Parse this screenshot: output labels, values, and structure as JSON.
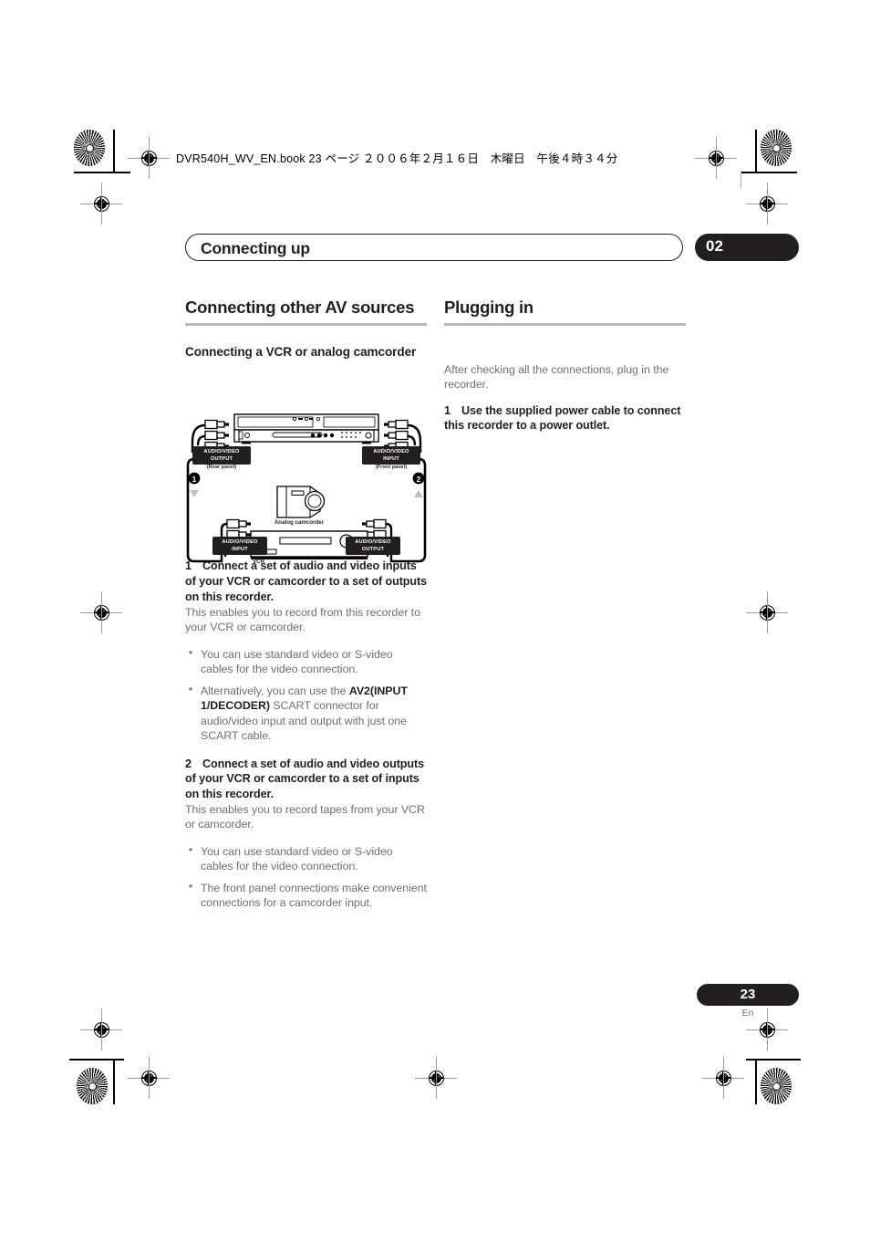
{
  "print_marks": {
    "book_line": "DVR540H_WV_EN.book  23 ページ  ２００６年２月１６日　木曜日　午後４時３４分"
  },
  "running_head": {
    "title": "Connecting up",
    "chapter_number": "02"
  },
  "left_column": {
    "section_title": "Connecting other AV sources",
    "subsection_title": "Connecting a VCR or analog camcorder",
    "step1": {
      "number": "1",
      "heading": "Connect a set of audio and video inputs of your VCR or camcorder to a set of outputs on this recorder.",
      "body": "This enables you to record from this recorder to your VCR or camcorder.",
      "bullets": [
        {
          "text_before": "You can use standard video or S-video cables for the video connection.",
          "bold": "",
          "text_after": ""
        },
        {
          "text_before": "Alternatively, you can use the ",
          "bold": "AV2(INPUT 1/DECODER)",
          "text_after": " SCART connector for audio/video input and output with just one SCART cable."
        }
      ]
    },
    "step2": {
      "number": "2",
      "heading": "Connect a set of audio and video outputs of your VCR or camcorder to a set of inputs on this recorder.",
      "body": "This enables you to record tapes from your VCR or camcorder.",
      "bullets": [
        {
          "text_before": "You can use standard video or S-video cables for the video connection.",
          "bold": "",
          "text_after": ""
        },
        {
          "text_before": "The front panel connections make convenient connections for a camcorder input.",
          "bold": "",
          "text_after": ""
        }
      ]
    }
  },
  "right_column": {
    "section_title": "Plugging in",
    "intro": "After checking all the connections, plug in the recorder.",
    "step1": {
      "number": "1",
      "heading": "Use the supplied power cable to connect this recorder to a power outlet."
    }
  },
  "figure": {
    "labels": {
      "top_left_box_line1": "AUDIO/VIDEO",
      "top_left_box_line2": "OUTPUT",
      "top_left_caption": "(Rear panel)",
      "top_right_box_line1": "AUDIO/VIDEO",
      "top_right_box_line2": "INPUT",
      "top_right_caption": "(Front panel)",
      "bottom_left_box_line1": "AUDIO/VIDEO",
      "bottom_left_box_line2": "INPUT",
      "bottom_right_box_line1": "AUDIO/VIDEO",
      "bottom_right_box_line2": "OUTPUT",
      "camcorder": "Analog camcorder",
      "vcr": "VCR",
      "callout_1": "1",
      "callout_2": "2"
    }
  },
  "footer": {
    "page_number": "23",
    "language": "En"
  }
}
